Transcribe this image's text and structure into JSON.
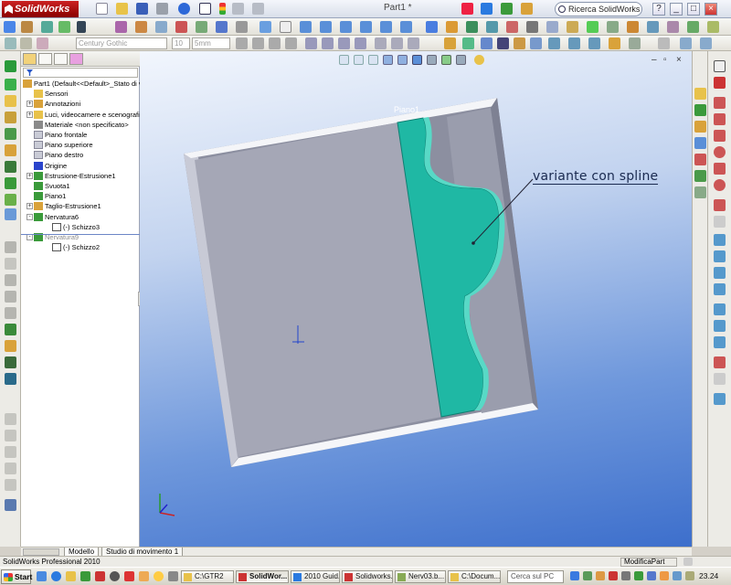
{
  "window": {
    "app_name": "SolidWorks",
    "doc_title": "Part1 *",
    "search_placeholder": "Ricerca SolidWorks",
    "controls": {
      "help": "?",
      "minimize": "_",
      "maximize": "□",
      "close": "×"
    }
  },
  "toolbar_text": {
    "font_name": "Century Gothic",
    "font_size": "10",
    "height": "5mm"
  },
  "feature_tree": {
    "items": [
      {
        "label": "Part1  (Default<<Default>_Stato di v",
        "icon": "part-icon",
        "indent": 0,
        "expander": ""
      },
      {
        "label": "Sensori",
        "icon": "sensor-icon",
        "indent": 1,
        "expander": ""
      },
      {
        "label": "Annotazioni",
        "icon": "annotation-icon",
        "indent": 1,
        "expander": "+"
      },
      {
        "label": "Luci, videocamere e scenografie",
        "icon": "lights-icon",
        "indent": 1,
        "expander": "+"
      },
      {
        "label": "Materiale <non specificato>",
        "icon": "material-icon",
        "indent": 1,
        "expander": ""
      },
      {
        "label": "Piano frontale",
        "icon": "plane-icon",
        "indent": 1,
        "expander": ""
      },
      {
        "label": "Piano superiore",
        "icon": "plane-icon",
        "indent": 1,
        "expander": ""
      },
      {
        "label": "Piano destro",
        "icon": "plane-icon",
        "indent": 1,
        "expander": ""
      },
      {
        "label": "Origine",
        "icon": "origin-icon",
        "indent": 1,
        "expander": ""
      },
      {
        "label": "Estrusione-Estrusione1",
        "icon": "extrude-icon",
        "indent": 1,
        "expander": "+"
      },
      {
        "label": "Svuota1",
        "icon": "shell-icon",
        "indent": 1,
        "expander": ""
      },
      {
        "label": "Piano1",
        "icon": "plane-feature-icon",
        "indent": 1,
        "expander": ""
      },
      {
        "label": "Taglio-Estrusione1",
        "icon": "cut-extrude-icon",
        "indent": 1,
        "expander": "+"
      },
      {
        "label": "Nervatura6",
        "icon": "rib-icon",
        "indent": 1,
        "expander": "-"
      },
      {
        "label": "(-) Schizzo3",
        "icon": "sketch-icon",
        "indent": 2,
        "expander": ""
      },
      {
        "label": "Nervatura9",
        "icon": "rib-icon",
        "indent": 1,
        "expander": "-",
        "gray": true
      },
      {
        "label": "(-) Schizzo2",
        "icon": "sketch-icon",
        "indent": 2,
        "expander": ""
      }
    ]
  },
  "viewport": {
    "annotation": "variante con spline",
    "plane_label": "Piano1",
    "colors": {
      "rib": "#1fb8a4",
      "body": "#a5a7b6",
      "bg_top": "#f2f6fd",
      "bg_bottom": "#3d6fcc"
    }
  },
  "bottom_tabs": {
    "model": "Modello",
    "motion": "Studio di movimento 1"
  },
  "status": {
    "left": "SolidWorks Professional 2010",
    "right": "ModificaPart"
  },
  "taskbar": {
    "start": "Start",
    "tasks": [
      {
        "label": "C:\\GTR2",
        "icon": "folder"
      },
      {
        "label": "SolidWor...",
        "icon": "sw",
        "active": true
      },
      {
        "label": "2010 Guid...",
        "icon": "ie"
      },
      {
        "label": "Solidworks...",
        "icon": "sw"
      },
      {
        "label": "Nerv03.b...",
        "icon": "img"
      },
      {
        "label": "C:\\Docum...",
        "icon": "folder"
      }
    ],
    "search_placeholder": "Cerca sul PC",
    "clock": "23.24"
  }
}
